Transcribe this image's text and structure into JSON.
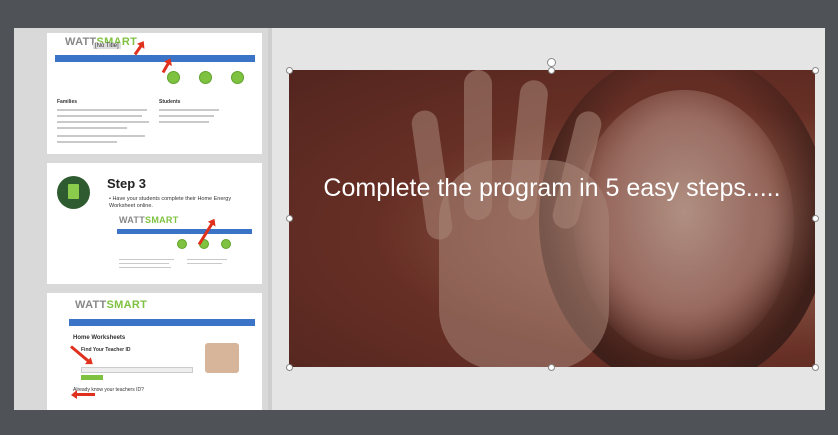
{
  "sidebar": {
    "thumb1": {
      "logo_a": "WATT",
      "logo_b": "SMART",
      "no_title": "[No Title]",
      "families_heading": "Families",
      "students_heading": "Students"
    },
    "thumb2": {
      "title": "Step 3",
      "bullet": "• Have your students complete their Home Energy Worksheet online.",
      "logo_a": "WATT",
      "logo_b": "SMART"
    },
    "thumb3": {
      "logo_a": "WATT",
      "logo_b": "SMART",
      "heading": "Home Worksheets",
      "find_label": "Find Your Teacher ID",
      "already_label": "Already know your teachers ID?"
    }
  },
  "slide": {
    "text": "Complete the program in 5 easy steps....."
  }
}
